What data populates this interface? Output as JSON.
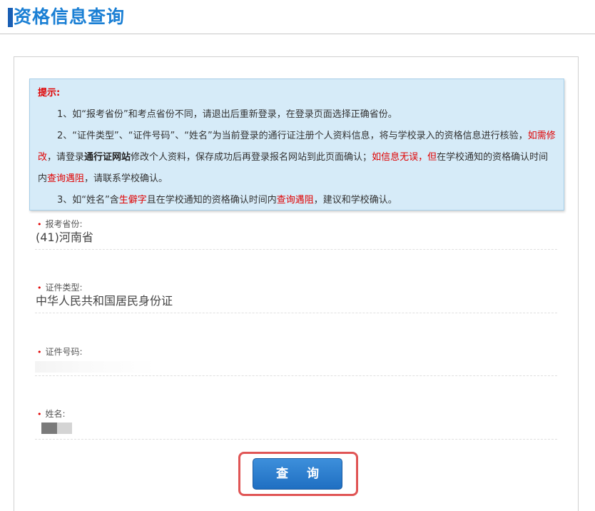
{
  "header": {
    "title": "资格信息查询"
  },
  "notice": {
    "title": "提示:",
    "items": [
      {
        "segments": [
          {
            "text": "1、如“报考省份”和考点省份不同，请退出后重新登录，在登录页面选择正确省份。",
            "style": "normal"
          }
        ]
      },
      {
        "segments": [
          {
            "text": "2、“证件类型”、“证件号码”、“姓名”为当前登录的通行证注册个人资料信息，将与学校录入的资格信息进行核验，",
            "style": "normal"
          },
          {
            "text": "如需修改",
            "style": "red"
          },
          {
            "text": "，请登录",
            "style": "normal"
          },
          {
            "text": "通行证网站",
            "style": "bold"
          },
          {
            "text": "修改个人资料，保存成功后再登录报名网站到此页面确认；",
            "style": "normal"
          },
          {
            "text": "如信息无误，但",
            "style": "red"
          },
          {
            "text": "在学校通知的资格确认时间内",
            "style": "normal"
          },
          {
            "text": "查询遇阻",
            "style": "red"
          },
          {
            "text": "，请联系学校确认。",
            "style": "normal"
          }
        ]
      },
      {
        "segments": [
          {
            "text": "3、如“姓名”含",
            "style": "normal"
          },
          {
            "text": "生僻字",
            "style": "red"
          },
          {
            "text": "且在学校通知的资格确认时间内",
            "style": "normal"
          },
          {
            "text": "查询遇阻",
            "style": "red"
          },
          {
            "text": "，建议和学校确认。",
            "style": "normal"
          }
        ]
      }
    ]
  },
  "form": {
    "province": {
      "label": "报考省份:",
      "value": "(41)河南省"
    },
    "id_type": {
      "label": "证件类型:",
      "value": "中华人民共和国居民身份证"
    },
    "id_number": {
      "label": "证件号码:"
    },
    "name": {
      "label": "姓名:"
    },
    "required_mark": "•"
  },
  "actions": {
    "query_label": "查询"
  },
  "colors": {
    "accent": "#1a7fd4",
    "notice_bg": "#d6ebf8",
    "warning_red": "#e00000",
    "highlight": "#e05555"
  }
}
